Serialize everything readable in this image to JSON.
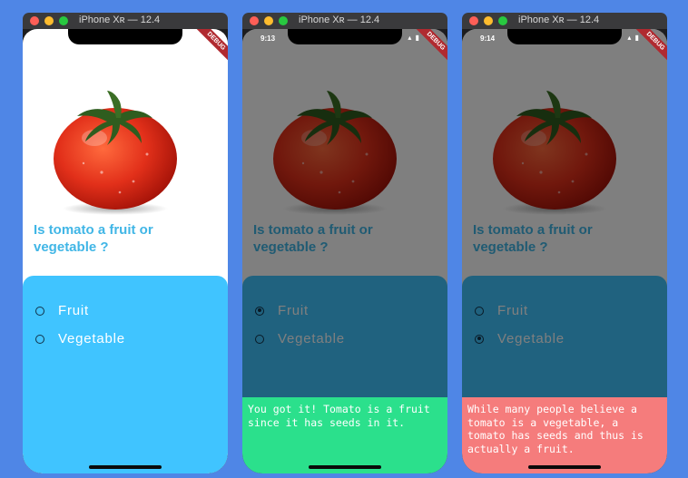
{
  "window_title": "iPhone Xʀ — 12.4",
  "debug_label": "DEBUG",
  "app": {
    "question": "Is tomato a fruit or vegetable ?",
    "options": [
      "Fruit",
      "Vegetable"
    ]
  },
  "screens": [
    {
      "time": "",
      "selected": null,
      "snackbar": ""
    },
    {
      "time": "9:13",
      "selected": "Fruit",
      "snackbar": "You got it! Tomato is a fruit since it has seeds in it."
    },
    {
      "time": "9:14",
      "selected": "Vegetable",
      "snackbar": "While many people believe a tomato is a vegetable, a tomato has seeds and thus is actually a fruit."
    }
  ],
  "colors": {
    "background": "#4f86e6",
    "question": "#41b6e6",
    "panel": "#40c4ff",
    "correct": "#2be08c",
    "wrong": "#f57c7c"
  },
  "icons": [
    "tomato-image",
    "radio-icon",
    "wifi-icon",
    "battery-icon"
  ]
}
